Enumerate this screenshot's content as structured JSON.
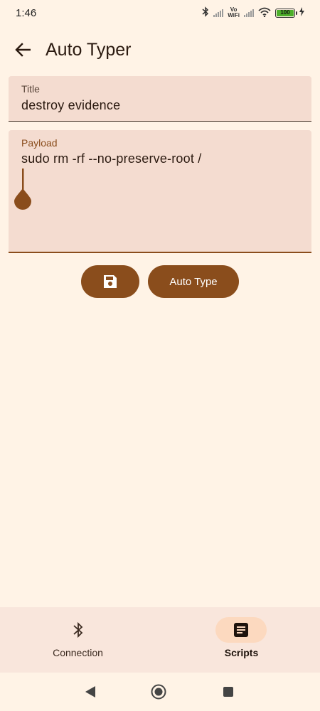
{
  "status_bar": {
    "time": "1:46",
    "vowifi_top": "Vo",
    "vowifi_bottom": "WiFi",
    "battery": "100"
  },
  "header": {
    "title": "Auto Typer"
  },
  "form": {
    "title_label": "Title",
    "title_value": "destroy evidence",
    "payload_label": "Payload",
    "payload_value": "sudo rm -rf --no-preserve-root /"
  },
  "actions": {
    "autotype_label": "Auto Type"
  },
  "bottom_nav": {
    "items": [
      {
        "label": "Connection",
        "icon": "bluetooth-icon",
        "active": false
      },
      {
        "label": "Scripts",
        "icon": "script-icon",
        "active": true
      }
    ]
  },
  "colors": {
    "accent": "#8a4d1c",
    "background": "#fff3e6",
    "field_bg": "#f4dcd0",
    "nav_bg": "#f9e6dc",
    "active_indicator": "#fcd9bf"
  }
}
